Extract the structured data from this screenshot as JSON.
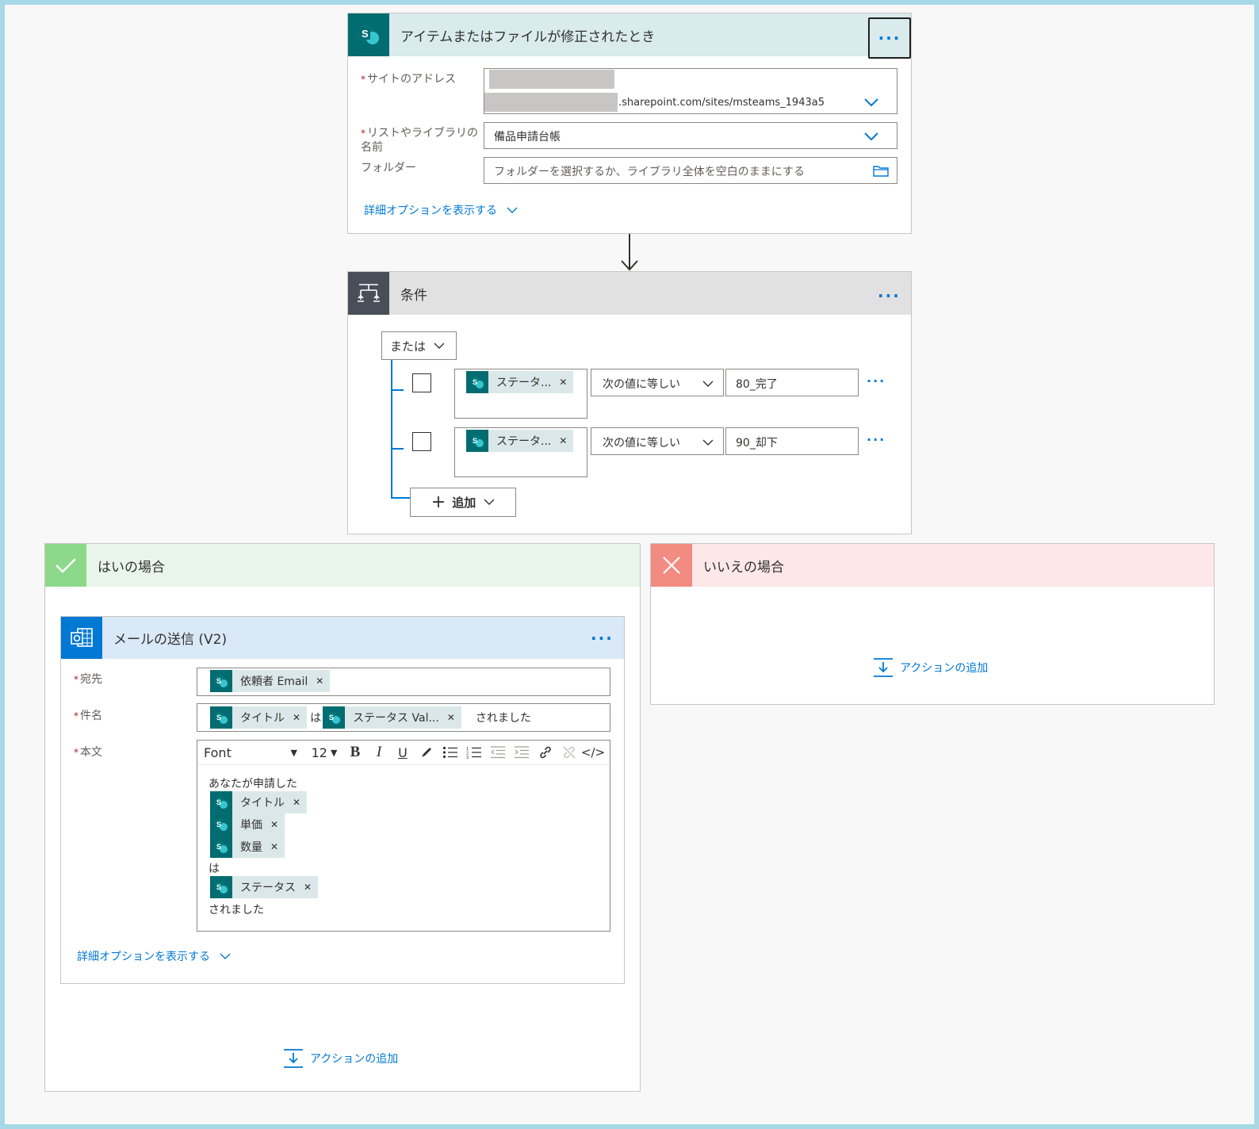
{
  "trigger": {
    "title": "アイテムまたはファイルが修正されたとき",
    "site_label": "サイトのアドレス",
    "site_value": ".sharepoint.com/sites/msteams_1943a5",
    "list_label_1": "リストやライブラリの",
    "list_label_2": "名前",
    "list_value": "備品申請台帳",
    "folder_label": "フォルダー",
    "folder_placeholder": "フォルダーを選択するか、ライブラリ全体を空白のままにする",
    "advanced_link": "詳細オプションを表示する"
  },
  "condition": {
    "title": "条件",
    "group_operator": "または",
    "rows": [
      {
        "token": "ステータ...",
        "operator": "次の値に等しい",
        "value": "80_完了"
      },
      {
        "token": "ステータ...",
        "operator": "次の値に等しい",
        "value": "90_却下"
      }
    ],
    "add_label": "追加"
  },
  "yes_branch": {
    "title": "はいの場合",
    "add_action": "アクションの追加"
  },
  "no_branch": {
    "title": "いいえの場合",
    "add_action": "アクションの追加"
  },
  "mail": {
    "title": "メールの送信 (V2)",
    "to_label": "宛先",
    "to_token": "依頼者 Email",
    "subject_label": "件名",
    "subject_token1": "タイトル",
    "subject_connector": "は",
    "subject_token2": "ステータス Val...",
    "subject_suffix": "されました",
    "body_label": "本文",
    "toolbar": {
      "font": "Font",
      "size": "12",
      "bold": "B",
      "italic": "I",
      "underline": "U",
      "code": "</>"
    },
    "body": {
      "line1": "あなたが申請した",
      "token_title": "タイトル",
      "token_price": "単価",
      "token_qty": "数量",
      "connector": "は",
      "token_status": "ステータス",
      "suffix": "されました"
    },
    "advanced_link": "詳細オプションを表示する"
  },
  "colors": {
    "sharepoint": "#036c70",
    "trigger_header": "#d9ebec",
    "condition_icon": "#484f58",
    "condition_header": "#e1e1e1",
    "yes": "#8cd98c",
    "yes_header": "#e9f5ea",
    "no": "#f28b82",
    "no_header": "#fde7e9",
    "outlook": "#0078d4",
    "mail_header": "#dae9f8",
    "link": "#0078d4",
    "page_frame": "#a6d8e6"
  }
}
